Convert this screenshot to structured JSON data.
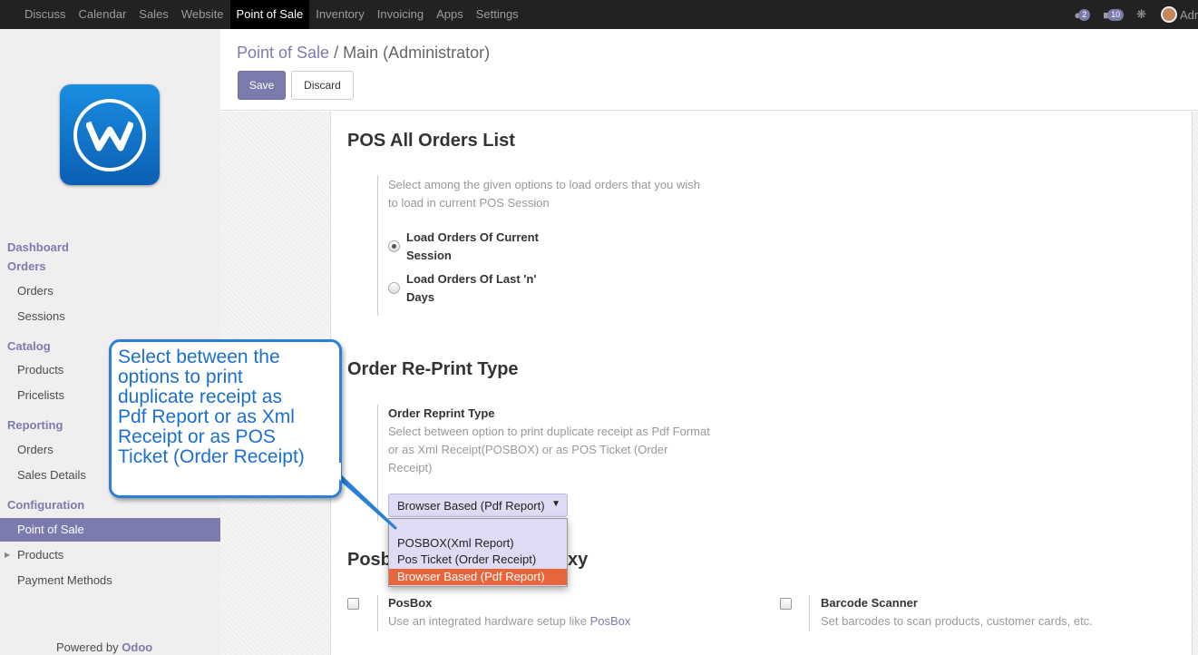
{
  "topbar": {
    "menu": [
      "Discuss",
      "Calendar",
      "Sales",
      "Website",
      "Point of Sale",
      "Inventory",
      "Invoicing",
      "Apps",
      "Settings"
    ],
    "active": "Point of Sale",
    "conversations_count": "2",
    "messages_count": "10",
    "user": "Adr"
  },
  "sidebar": {
    "dashboard": "Dashboard",
    "orders_header": "Orders",
    "orders": "Orders",
    "sessions": "Sessions",
    "catalog": "Catalog",
    "products": "Products",
    "pricelists": "Pricelists",
    "reporting": "Reporting",
    "reporting_orders": "Orders",
    "sales_details": "Sales Details",
    "configuration": "Configuration",
    "point_of_sale": "Point of Sale",
    "config_products": "Products",
    "payment_methods": "Payment Methods",
    "powered_by": "Powered by",
    "odoo": "Odoo"
  },
  "breadcrumb": {
    "parent": "Point of Sale",
    "separator": "/",
    "current": "Main (Administrator)"
  },
  "buttons": {
    "save": "Save",
    "discard": "Discard"
  },
  "sections": {
    "orders_list": {
      "title": "POS All Orders List",
      "help_line1": "Select among the given options to load orders that you wish",
      "help_line2": "to load in current POS Session",
      "opt1_line1": "Load Orders Of Current",
      "opt1_line2": "Session",
      "opt2_line1": "Load Orders Of Last 'n'",
      "opt2_line2": "Days",
      "selected": "current_session"
    },
    "reprint": {
      "title": "Order Re-Print Type",
      "field_label": "Order Reprint Type",
      "help_line1": "Select between option to print duplicate receipt as Pdf Format",
      "help_line2": "or as Xml Receipt(POSBOX) or as POS Ticket (Order",
      "help_line3": "Receipt)",
      "select_value": "Browser Based (Pdf Report)",
      "options": [
        "POSBOX(Xml Report)",
        "Pos Ticket (Order Receipt)",
        "Browser Based (Pdf Report)"
      ]
    },
    "posbox": {
      "title_left": "Posb",
      "title_right": "xy",
      "posbox_label": "PosBox",
      "posbox_help": "Use an integrated hardware setup like",
      "posbox_link": "PosBox",
      "barcode_label": "Barcode Scanner",
      "barcode_help": "Set barcodes to scan products, customer cards, etc."
    }
  },
  "callout": {
    "line1": "Select between the",
    "line2": "options to print",
    "line3": "duplicate receipt as",
    "line4": "Pdf Report or as Xml",
    "line5": "Receipt or as POS",
    "line6": "Ticket (Order Receipt)"
  }
}
